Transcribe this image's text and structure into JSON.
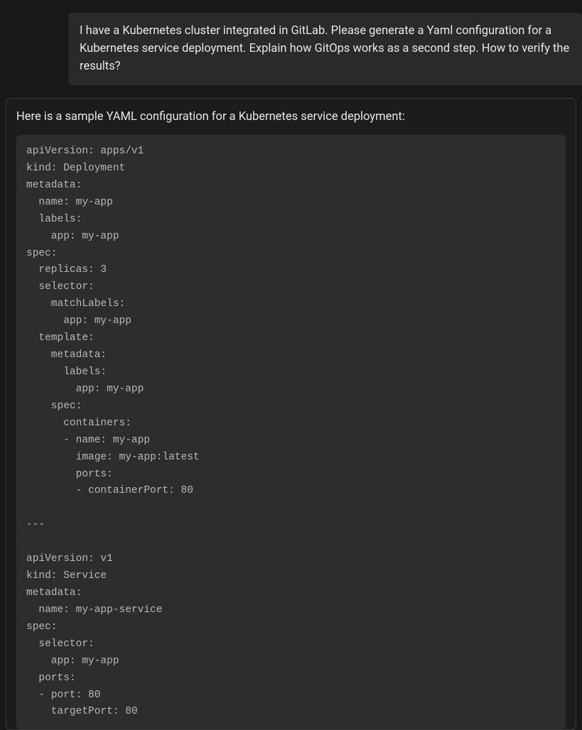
{
  "user_message": "I have a Kubernetes cluster integrated in GitLab. Please generate a Yaml configuration for a Kubernetes service deployment. Explain how GitOps works as a second step. How to verify the results?",
  "assistant_intro": "Here is a sample YAML configuration for a Kubernetes service deployment:",
  "code_content": "apiVersion: apps/v1\nkind: Deployment\nmetadata:\n  name: my-app\n  labels:\n    app: my-app\nspec:\n  replicas: 3\n  selector:\n    matchLabels:\n      app: my-app\n  template:\n    metadata:\n      labels:\n        app: my-app\n    spec:\n      containers:\n      - name: my-app\n        image: my-app:latest\n        ports:\n        - containerPort: 80\n\n---\n\napiVersion: v1\nkind: Service\nmetadata:\n  name: my-app-service\nspec:\n  selector:\n    app: my-app\n  ports:\n  - port: 80\n    targetPort: 80"
}
